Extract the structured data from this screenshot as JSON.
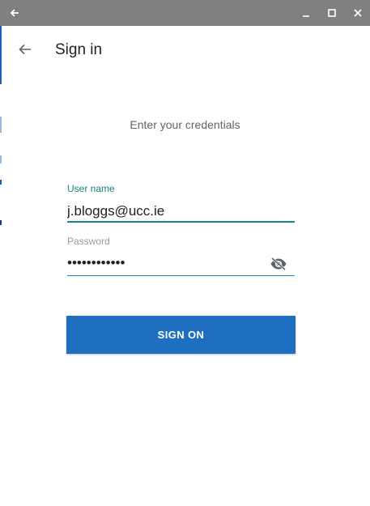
{
  "titlebar": {
    "background": "#808080",
    "icons": [
      "back-arrow-icon",
      "minimize-icon",
      "maximize-icon",
      "close-icon"
    ]
  },
  "appbar": {
    "title": "Sign in",
    "back_icon": "arrow-left-icon"
  },
  "form": {
    "subtitle": "Enter your credentials",
    "username": {
      "label": "User name",
      "value": "j.bloggs@ucc.ie"
    },
    "password": {
      "label": "Password",
      "masked_value": "••••••••••••",
      "toggle_icon": "eye-off-icon"
    },
    "submit_label": "SIGN ON"
  },
  "colors": {
    "accent_teal": "#16857f",
    "button_blue": "#1f6fc1",
    "password_underline": "#1e88c8"
  }
}
